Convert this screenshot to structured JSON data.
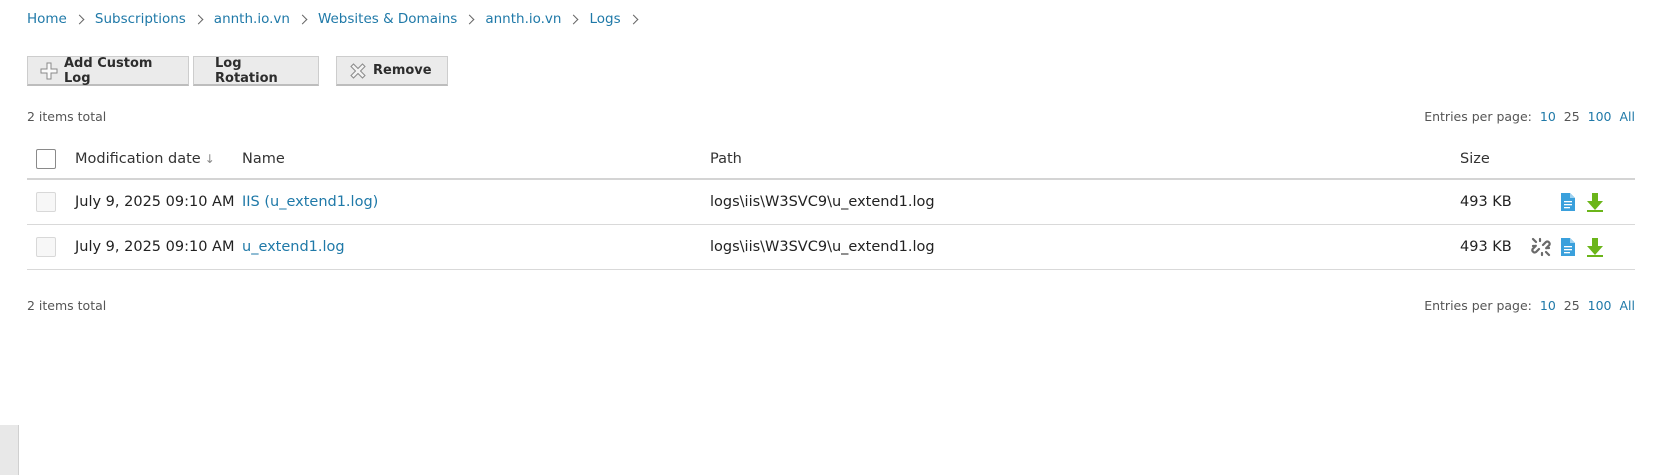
{
  "breadcrumb": {
    "items": [
      "Home",
      "Subscriptions",
      "annth.io.vn",
      "Websites & Domains",
      "annth.io.vn",
      "Logs"
    ]
  },
  "toolbar": {
    "add_custom_log_label": "Add Custom Log",
    "log_rotation_label": "Log Rotation",
    "remove_label": "Remove"
  },
  "summary": {
    "items_total": "2 items total",
    "entries_per_page_label": "Entries per page:",
    "page_sizes": [
      "10",
      "25",
      "100",
      "All"
    ]
  },
  "table": {
    "columns": {
      "date": "Modification date",
      "name": "Name",
      "path": "Path",
      "size": "Size"
    },
    "rows": [
      {
        "date": "July 9, 2025 09:10 AM",
        "name": "IIS (u_extend1.log)",
        "path": "logs\\iis\\W3SVC9\\u_extend1.log",
        "size": "493 KB",
        "actions": [
          "view-file-icon",
          "download-icon"
        ]
      },
      {
        "date": "July 9, 2025 09:10 AM",
        "name": "u_extend1.log",
        "path": "logs\\iis\\W3SVC9\\u_extend1.log",
        "size": "493 KB",
        "actions": [
          "unlink-icon",
          "view-file-icon",
          "download-icon"
        ]
      }
    ]
  },
  "colors": {
    "link": "#1f79a8",
    "download_green": "#6bb51a",
    "file_blue": "#3aa0dc"
  }
}
